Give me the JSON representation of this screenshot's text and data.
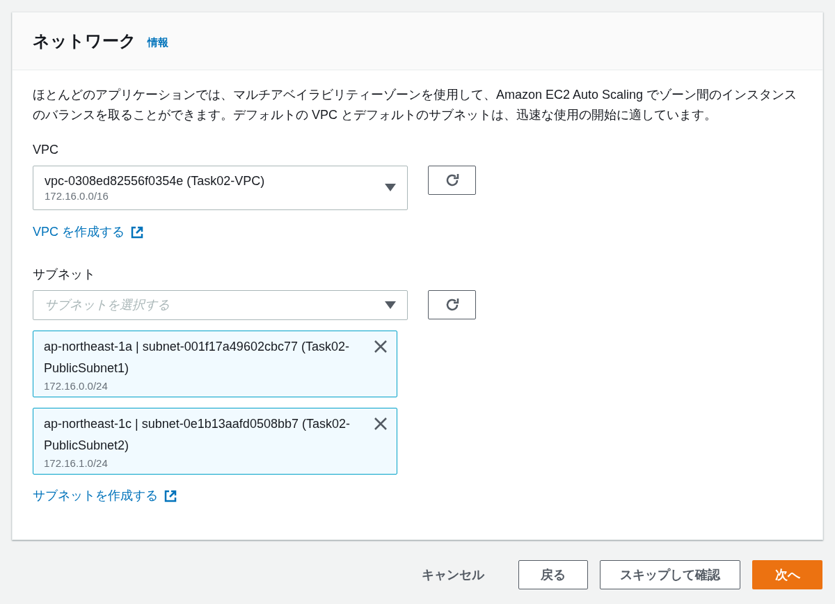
{
  "header": {
    "title": "ネットワーク",
    "info_link": "情報"
  },
  "description": "ほとんどのアプリケーションでは、マルチアベイラビリティーゾーンを使用して、Amazon EC2 Auto Scaling でゾーン間のインスタンスのバランスを取ることができます。デフォルトの VPC とデフォルトのサブネットは、迅速な使用の開始に適しています。",
  "vpc": {
    "label": "VPC",
    "value": "vpc-0308ed82556f0354e (Task02-VPC)",
    "detail": "172.16.0.0/16",
    "create_link": "VPC を作成する"
  },
  "subnet": {
    "label": "サブネット",
    "placeholder": "サブネットを選択する",
    "tokens": [
      {
        "name": "ap-northeast-1a | subnet-001f17a49602cbc77 (Task02-PublicSubnet1)",
        "detail": "172.16.0.0/24"
      },
      {
        "name": "ap-northeast-1c | subnet-0e1b13aafd0508bb7 (Task02-PublicSubnet2)",
        "detail": "172.16.1.0/24"
      }
    ],
    "create_link": "サブネットを作成する"
  },
  "footer_buttons": [
    {
      "kind": "link",
      "label": "キャンセル"
    },
    {
      "kind": "normal",
      "label": "戻る"
    },
    {
      "kind": "normal",
      "label": "スキップして確認"
    },
    {
      "kind": "primary",
      "label": "次へ"
    }
  ]
}
